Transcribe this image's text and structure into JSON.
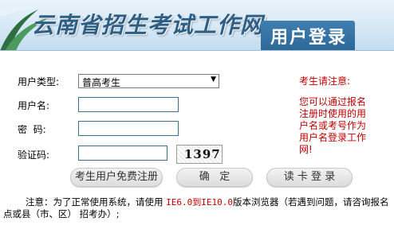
{
  "header": {
    "site_title": "云南省招生考试工作网",
    "login_tab": "用户登录"
  },
  "form": {
    "user_type_label": "用户类型:",
    "user_type_value": "普高考生",
    "username_label": "用户名:",
    "username_value": "",
    "password_label": "密  码:",
    "password_value": "",
    "captcha_label": "验证码:",
    "captcha_value": "",
    "captcha_image_text": "1397"
  },
  "buttons": {
    "register": "考生用户免费注册",
    "confirm": "确   定",
    "read_card": "读 卡 登 录"
  },
  "notice": {
    "title": "考生请注意:",
    "body": "您可以通过报名注册时使用的用户名或考号作为用户名登录工作网!"
  },
  "footer": {
    "prefix": "注意：为了正常使用系统，请使用 ",
    "browser": "IE6.0到IE10.0",
    "suffix": "版本浏览器（若遇到问题，请咨询报名点或县（市、区） 招考办）;"
  }
}
